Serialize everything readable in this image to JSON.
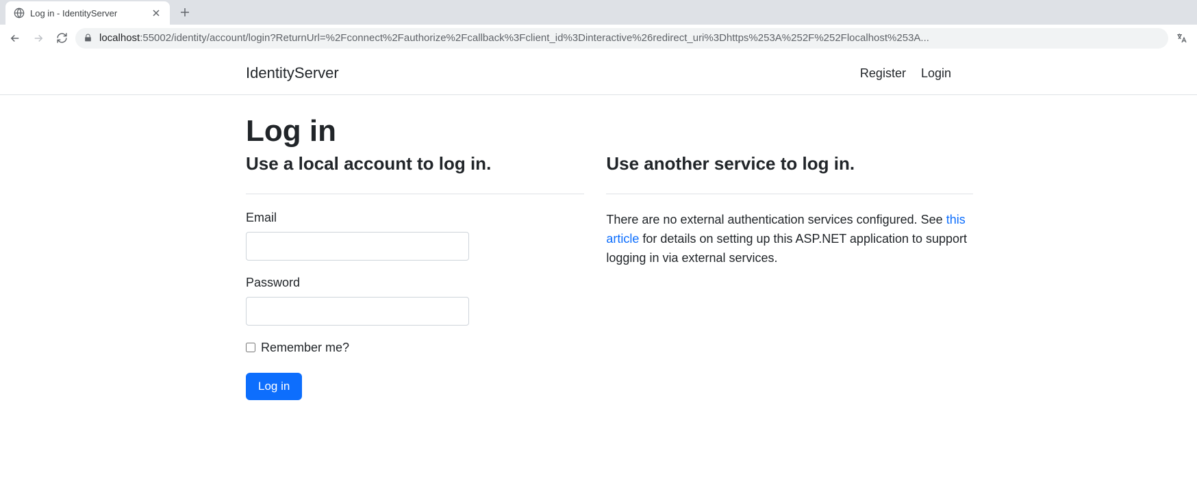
{
  "browser": {
    "tab_title": "Log in - IdentityServer",
    "url_host": "localhost",
    "url_port_path": ":55002/identity/account/login?ReturnUrl=%2Fconnect%2Fauthorize%2Fcallback%3Fclient_id%3Dinteractive%26redirect_uri%3Dhttps%253A%252F%252Flocalhost%253A..."
  },
  "navbar": {
    "brand": "IdentityServer",
    "register": "Register",
    "login": "Login"
  },
  "page": {
    "title": "Log in",
    "local": {
      "heading": "Use a local account to log in.",
      "email_label": "Email",
      "email_value": "",
      "password_label": "Password",
      "password_value": "",
      "remember_label": "Remember me?",
      "submit": "Log in"
    },
    "external": {
      "heading": "Use another service to log in.",
      "text_before": "There are no external authentication services configured. See ",
      "link_text": "this article",
      "text_after": " for details on setting up this ASP.NET application to support logging in via external services."
    }
  }
}
